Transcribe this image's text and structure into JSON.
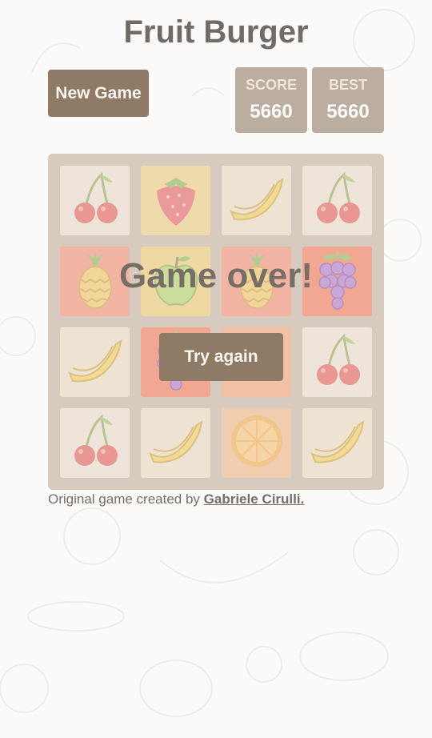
{
  "header": {
    "title": "Fruit Burger",
    "new_game_label": "New Game"
  },
  "scores": {
    "score_label": "SCORE",
    "score_value": "5660",
    "best_label": "BEST",
    "best_value": "5660"
  },
  "board": {
    "tiles": [
      [
        "cherry",
        "strawberry",
        "banana",
        "cherry"
      ],
      [
        "pineapple",
        "apple",
        "pineapple",
        "grape"
      ],
      [
        "banana",
        "grape",
        "melon",
        "cherry"
      ],
      [
        "cherry",
        "banana",
        "orange",
        "banana"
      ]
    ],
    "tile_colors": {
      "cherry": "#eee4da",
      "banana": "#ede0c8",
      "strawberry": "#edcf72",
      "apple": "#edcc61",
      "pineapple": "#f67c5f",
      "grape": "#f65e3b",
      "melon": "#f59563",
      "orange": "#f2b179"
    }
  },
  "overlay": {
    "message": "Game over!",
    "retry_label": "Try again"
  },
  "footer": {
    "text": "Original game created by ",
    "link_text": "Gabriele Cirulli."
  }
}
